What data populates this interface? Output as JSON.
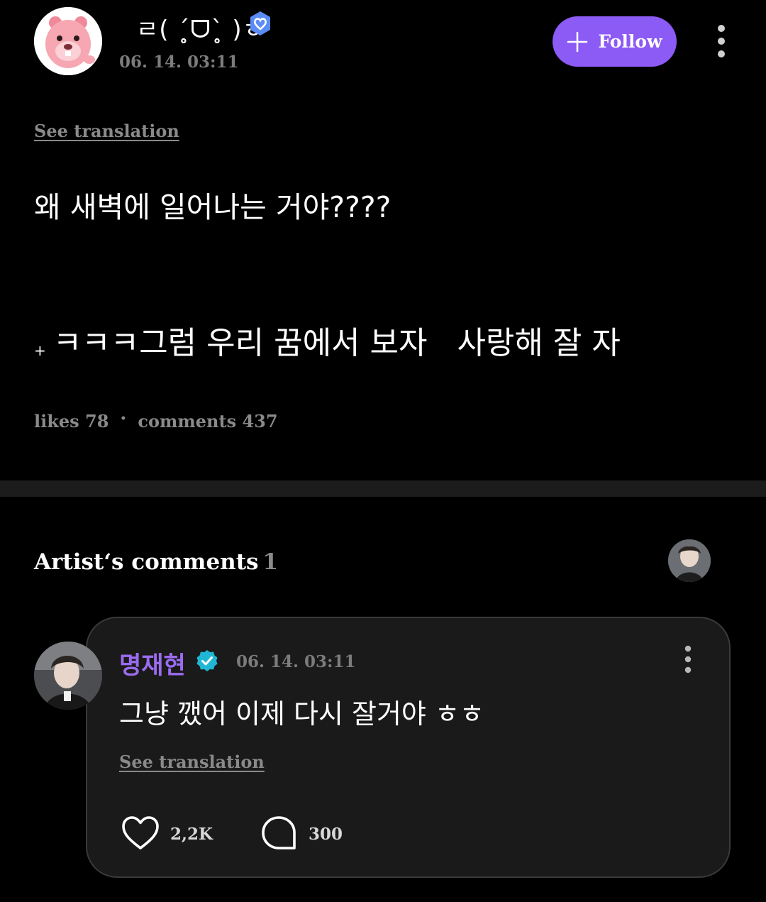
{
  "post": {
    "author_name": "ㄹ( ˊ̥̥ᗜˋ̥̥ )ㅎ",
    "timestamp": "06. 14. 03:11",
    "follow_label": "Follow",
    "see_translation": "See translation",
    "text_line1": "왜 새벽에 일어나는 거야????",
    "text_line2_prefix": "+",
    "text_line2": "ㅋㅋㅋ그럼 우리 꿈에서 보자   사랑해 잘 자",
    "likes_label": "likes 78",
    "stats_separator": "•",
    "comments_label": "comments 437"
  },
  "artist_comments": {
    "title": "Artist‘s comments",
    "count": "1"
  },
  "comment": {
    "author_name": "명재현",
    "timestamp": "06. 14. 03:11",
    "text": "그냥 깼어 이제 다시 잘거야 ㅎㅎ",
    "see_translation": "See translation",
    "like_count": "2,2K",
    "reply_count": "300"
  },
  "colors": {
    "background": "#000000",
    "accent": "#8c5af4",
    "artist_name": "#9b6cf0",
    "verified_badge": "#5b8cf5",
    "commenter_badge": "#1fb7d4",
    "muted_text": "#8a8a8a",
    "card_background": "#1a1a1a"
  },
  "icons": {
    "follow": "plus-icon",
    "post_menu": "more-vertical-icon",
    "like": "heart-outline-icon",
    "reply": "speech-bubble-icon"
  }
}
